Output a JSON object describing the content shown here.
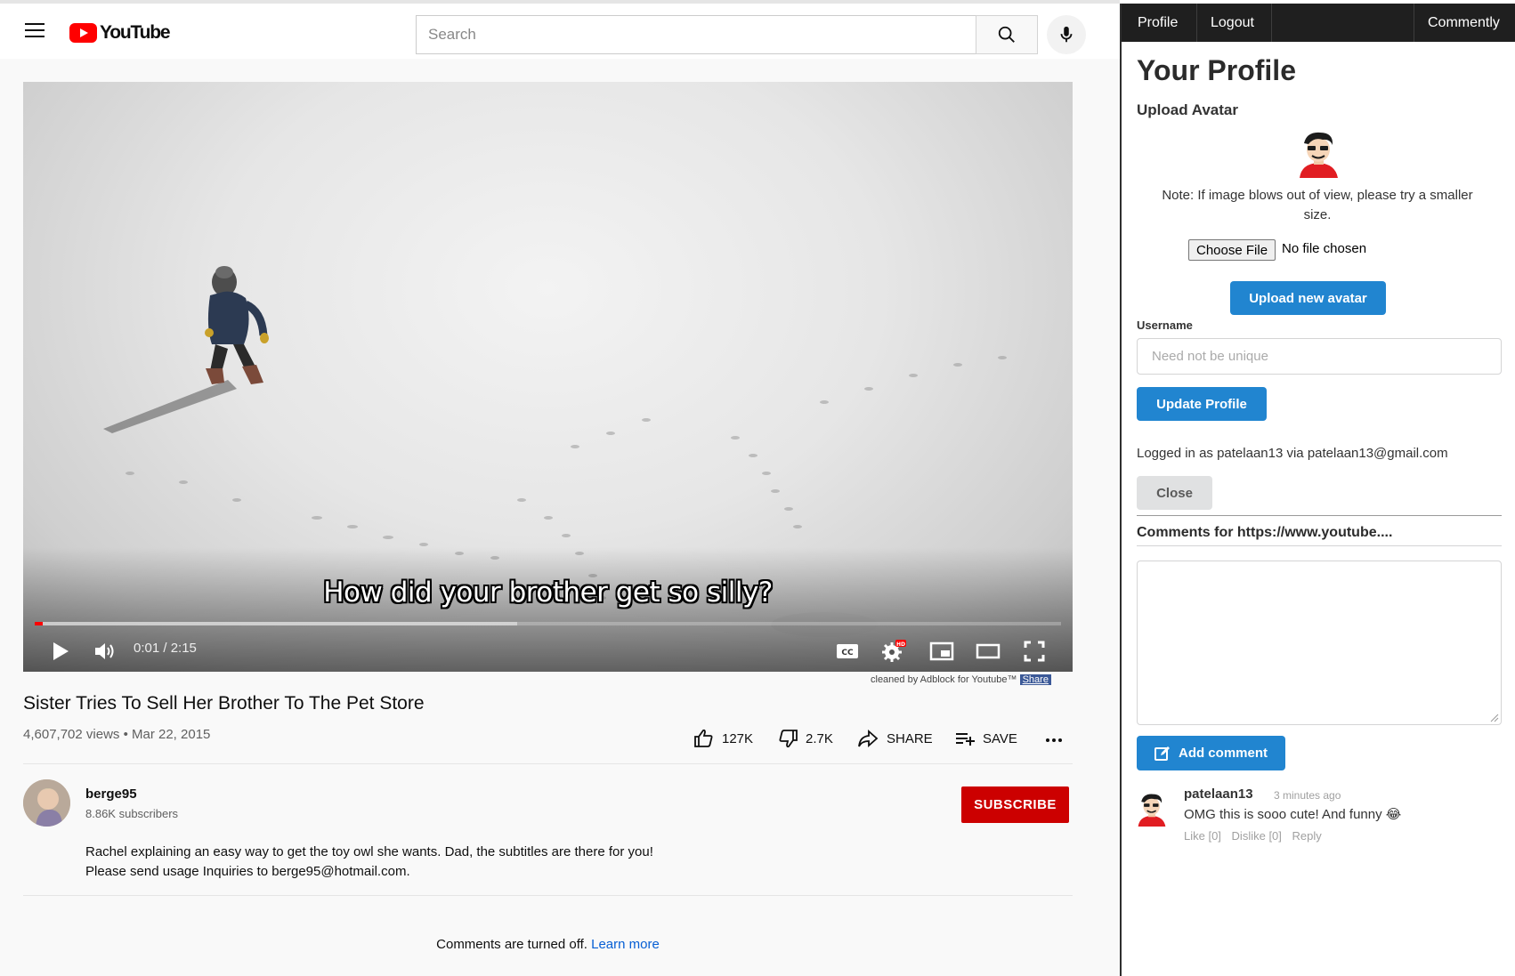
{
  "youtube": {
    "logo_text": "YouTube",
    "search_placeholder": "Search",
    "player": {
      "subtitle": "How did your brother get so silly?",
      "time": "0:01 / 2:15",
      "progress": 0.008,
      "buffered": 0.47,
      "credit_text": "cleaned by Adblock for Youtube™",
      "credit_share": "Share"
    },
    "video": {
      "title": "Sister Tries To Sell Her Brother To The Pet Store",
      "meta": "4,607,702 views • Mar 22, 2015",
      "likes": "127K",
      "dislikes": "2.7K",
      "share_label": "SHARE",
      "save_label": "SAVE"
    },
    "channel": {
      "name": "berge95",
      "subscribers": "8.86K subscribers",
      "subscribe_label": "SUBSCRIBE"
    },
    "description": {
      "line1": "Rachel explaining an easy way to get the toy owl she wants.  Dad, the subtitles are there for you!",
      "line2": "Please send usage Inquiries to berge95@hotmail.com."
    },
    "comments_off": {
      "text": "Comments are turned off.",
      "link": "Learn more"
    }
  },
  "panel": {
    "nav": {
      "profile": "Profile",
      "logout": "Logout",
      "brand": "Commently"
    },
    "title": "Your Profile",
    "upload_avatar_label": "Upload Avatar",
    "note": "Note: If image blows out of view, please try a smaller size.",
    "choose_file": "Choose File",
    "file_status": "No file chosen",
    "upload_button": "Upload new avatar",
    "username_label": "Username",
    "username_placeholder": "Need not be unique",
    "update_button": "Update Profile",
    "logged_in": "Logged in as patelaan13 via patelaan13@gmail.com",
    "close_button": "Close",
    "comments_heading": "Comments for https://www.youtube....",
    "add_comment": "Add comment",
    "comments": [
      {
        "author": "patelaan13",
        "time": "3 minutes ago",
        "text": "OMG this is sooo cute! And funny 😂",
        "like": "Like [0]",
        "dislike": "Dislike [0]",
        "reply": "Reply"
      }
    ]
  },
  "colors": {
    "youtube_red": "#ff0000",
    "subscribe_red": "#cc0000",
    "primary_blue": "#2185d0",
    "link_blue": "#065fd4",
    "nav_dark": "#1f1f1f"
  }
}
